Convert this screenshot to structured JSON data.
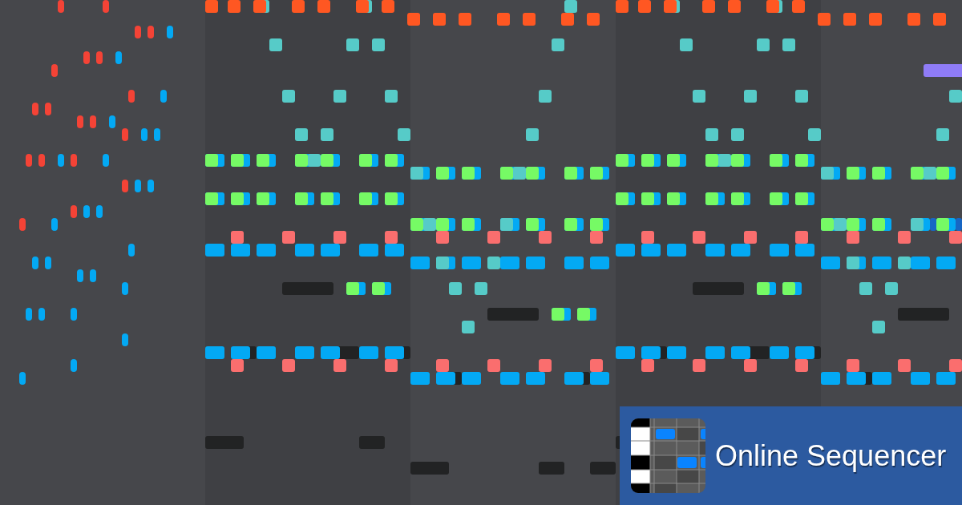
{
  "banner": {
    "title": "Online Sequencer"
  }
}
